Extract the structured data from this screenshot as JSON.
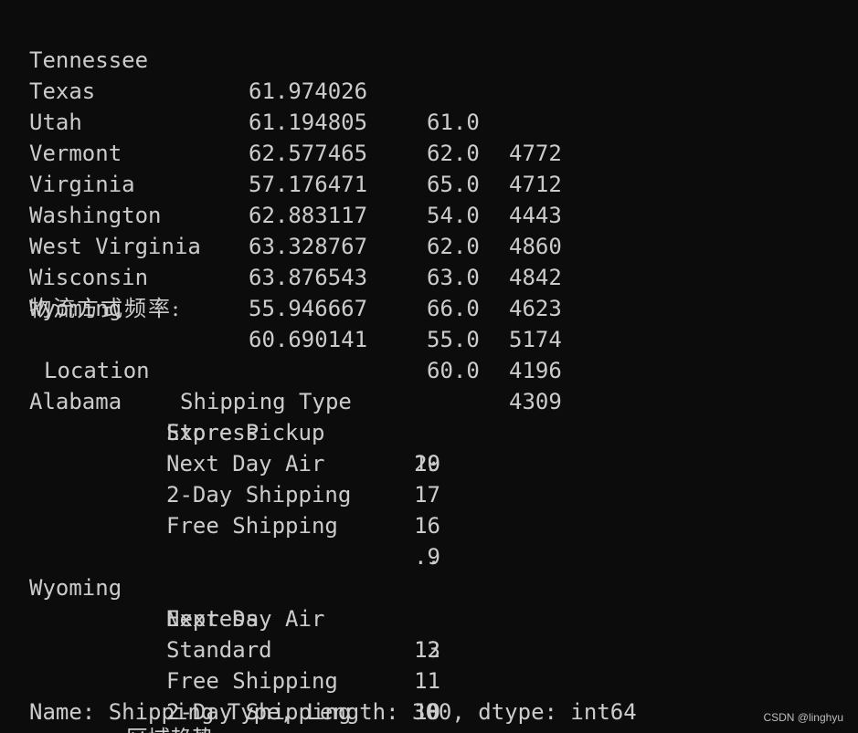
{
  "state_table": [
    {
      "state": "Tennessee",
      "mean": "61.974026",
      "median": "61.0",
      "count": "4772"
    },
    {
      "state": "Texas",
      "mean": "61.194805",
      "median": "62.0",
      "count": "4712"
    },
    {
      "state": "Utah",
      "mean": "62.577465",
      "median": "65.0",
      "count": "4443"
    },
    {
      "state": "Vermont",
      "mean": "57.176471",
      "median": "54.0",
      "count": "4860"
    },
    {
      "state": "Virginia",
      "mean": "62.883117",
      "median": "62.0",
      "count": "4842"
    },
    {
      "state": "Washington",
      "mean": "63.328767",
      "median": "63.0",
      "count": "4623"
    },
    {
      "state": "West Virginia",
      "mean": "63.876543",
      "median": "66.0",
      "count": "5174"
    },
    {
      "state": "Wisconsin",
      "mean": "55.946667",
      "median": "55.0",
      "count": "4196"
    },
    {
      "state": "Wyoming",
      "mean": "60.690141",
      "median": "60.0",
      "count": "4309"
    }
  ],
  "shipping_title": "物流方式频率:",
  "shipping_header": {
    "location": "Location",
    "shipping_type": "Shipping Type"
  },
  "shipping_rows": [
    {
      "location": "Alabama",
      "type": "Express",
      "count": "20"
    },
    {
      "location": "",
      "type": "Store Pickup",
      "count": "19"
    },
    {
      "location": "",
      "type": "Next Day Air",
      "count": "17"
    },
    {
      "location": "",
      "type": "2-Day Shipping",
      "count": "16"
    },
    {
      "location": "",
      "type": "Free Shipping",
      "count": "9"
    }
  ],
  "ellipsis": "..",
  "shipping_rows_2": [
    {
      "location": "Wyoming",
      "type": "Express",
      "count": "13"
    },
    {
      "location": "",
      "type": "Next Day Air",
      "count": "12"
    },
    {
      "location": "",
      "type": "Standard",
      "count": "11"
    },
    {
      "location": "",
      "type": "Free Shipping",
      "count": "10"
    },
    {
      "location": "",
      "type": "2-Day Shipping",
      "count": "8"
    }
  ],
  "summary": "Name: Shipping Type, Length: 300, dtype: int64",
  "clipped_next_line": "区域趋势",
  "watermark": "CSDN @linghyu"
}
